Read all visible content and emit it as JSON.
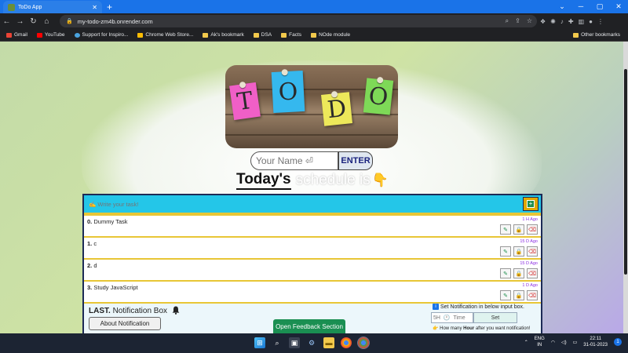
{
  "browser": {
    "tab_title": "ToDo App",
    "tab_close": "✕",
    "new_tab": "+",
    "url": "my-todo-zm4b.onrender.com",
    "bookmarks": [
      "Gmail",
      "YouTube",
      "Support for Inspiro...",
      "Chrome Web Store...",
      "Ak's bookmark",
      "DSA",
      "Facts",
      "NOde module"
    ],
    "other_bookmarks": "Other bookmarks"
  },
  "hero": {
    "letters": [
      "T",
      "O",
      "D",
      "O"
    ]
  },
  "name_form": {
    "placeholder": "Your Name ⏎",
    "enter_label": "ENTER"
  },
  "headline": {
    "bold": "Today's",
    "rest": "schedule is"
  },
  "task_input": {
    "placeholder": "✍ Write your task!"
  },
  "tasks": [
    {
      "index": "0.",
      "text": "Dummy Task",
      "ago": "1 H Ago"
    },
    {
      "index": "1.",
      "text": "c",
      "ago": "15 D Ago"
    },
    {
      "index": "2.",
      "text": "d",
      "ago": "15 D Ago"
    },
    {
      "index": "3.",
      "text": "Study JavaScript",
      "ago": "1 D Ago"
    }
  ],
  "notification": {
    "title_bold": "LAST.",
    "title_rest": "Notification Box",
    "about_label": "About Notification",
    "set_info": "Set Notification in below input box.",
    "hour_placeholder": "5H  🕐  Time",
    "set_label": "Set",
    "hint_pre": "How many",
    "hint_bold": "Hour",
    "hint_post": "after you want notification!"
  },
  "feedback_label": "Open Feedback Section",
  "taskbar": {
    "lang_top": "ENG",
    "lang_bottom": "IN",
    "time": "22:11",
    "date": "31-01-2023",
    "notif_count": "1"
  },
  "colors": {
    "tab_blue": "#1a73e8",
    "input_row": "#24c6e8",
    "panel_border": "#1c2b56",
    "panel_fill": "#e8c636",
    "feedback_green": "#1a8f52"
  }
}
